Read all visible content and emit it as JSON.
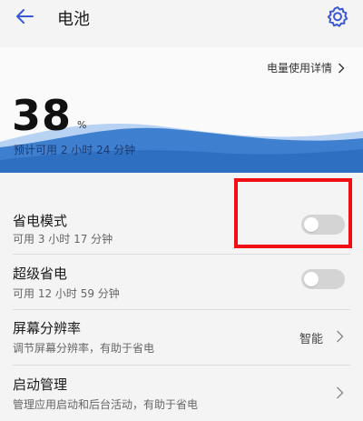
{
  "header": {
    "title": "电池",
    "back_icon": "arrow-left-icon",
    "settings_icon": "gear-icon"
  },
  "battery": {
    "usage_link": "电量使用详情",
    "percent": "38",
    "percent_unit": "%",
    "estimate": "预计可用 2 小时 24 分钟"
  },
  "settings": [
    {
      "label": "省电模式",
      "subtitle": "可用 3 小时 17 分钟",
      "control": "toggle",
      "on": false
    },
    {
      "label": "超级省电",
      "subtitle": "可用 12 小时 59 分钟",
      "control": "toggle",
      "on": false
    },
    {
      "label": "屏幕分辨率",
      "subtitle": "调节屏幕分辨率，有助于省电",
      "control": "link",
      "value": "智能"
    },
    {
      "label": "启动管理",
      "subtitle": "管理应用启动和后台活动，有助于省电",
      "control": "link",
      "value": ""
    }
  ],
  "colors": {
    "accent": "#3a58d6",
    "wave_dark": "#3070c6",
    "wave_light": "#6aa3e4",
    "highlight": "#f10d14",
    "toggle_off": "#d4d4d4"
  }
}
